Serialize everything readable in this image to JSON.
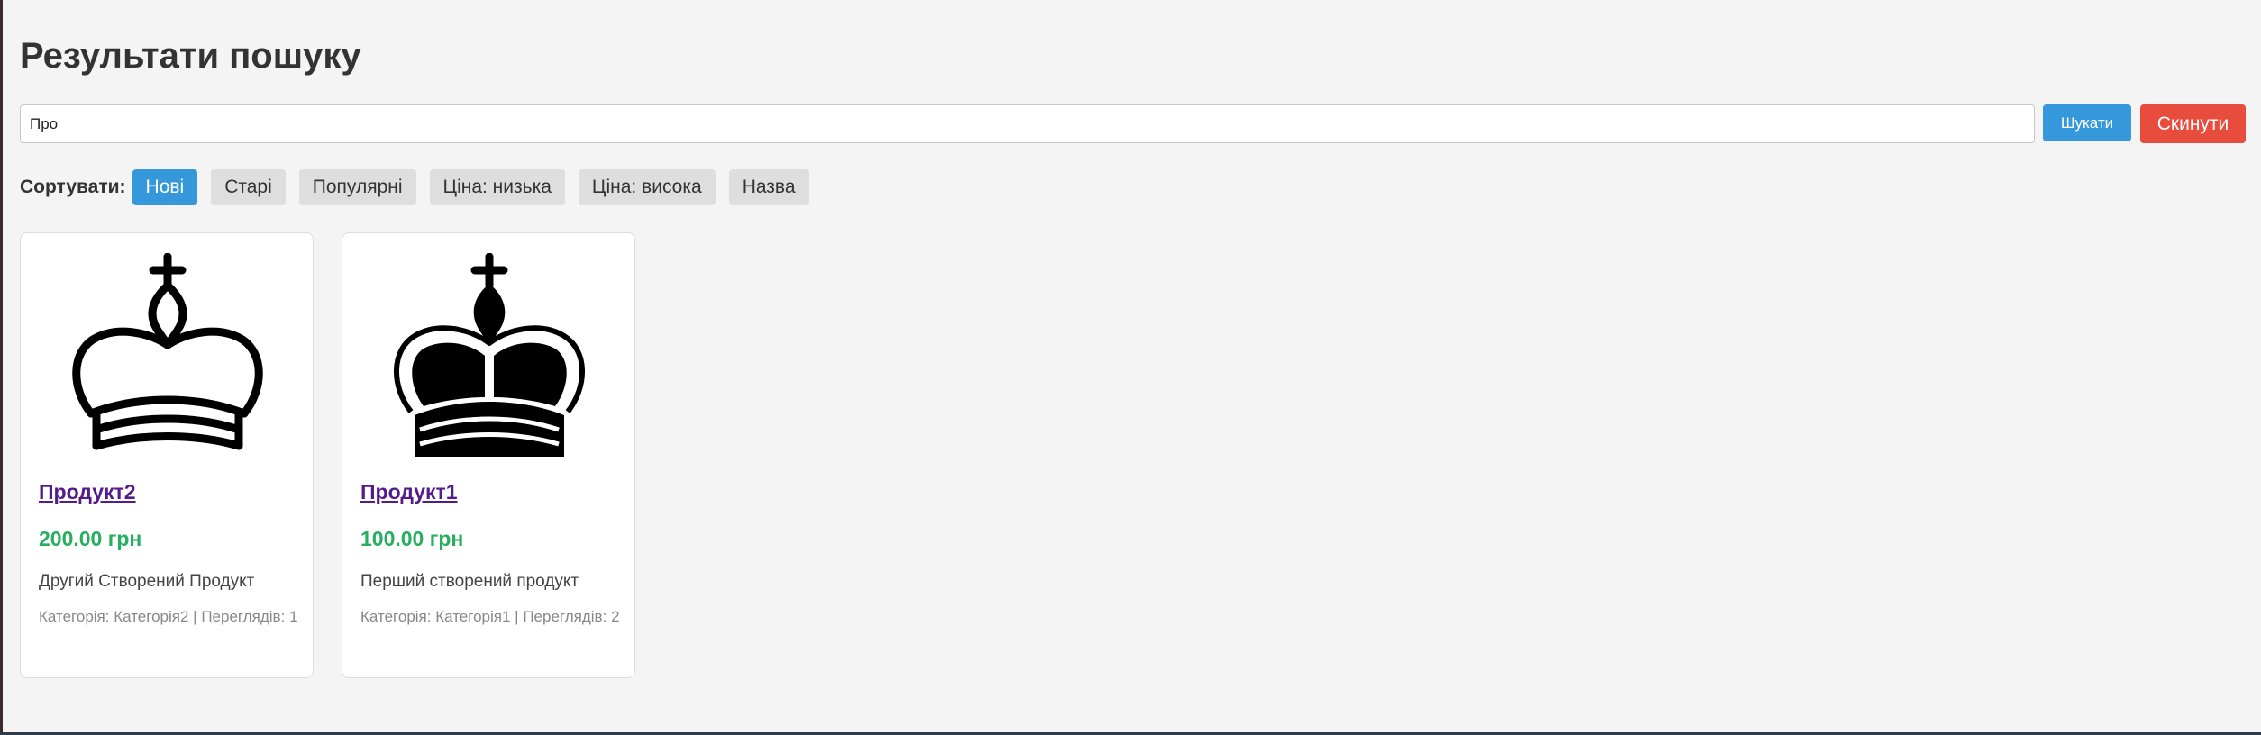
{
  "page": {
    "title": "Результати пошуку"
  },
  "search": {
    "value": "Про",
    "search_button": "Шукати",
    "reset_button": "Скинути"
  },
  "sort": {
    "label": "Сортувати:",
    "options": [
      "Нові",
      "Старі",
      "Популярні",
      "Ціна: низька",
      "Ціна: висока",
      "Назва"
    ],
    "active": "Нові"
  },
  "products": [
    {
      "name": "Продукт2",
      "price": "200.00 грн",
      "description": "Другий Створений Продукт",
      "category_label": "Категорія:",
      "category": "Категорія2",
      "views_label": "Переглядів:",
      "views": "1",
      "image": "white-king-icon"
    },
    {
      "name": "Продукт1",
      "price": "100.00 грн",
      "description": "Перший створений продукт",
      "category_label": "Категорія:",
      "category": "Категорія1",
      "views_label": "Переглядів:",
      "views": "2",
      "image": "black-king-icon"
    }
  ],
  "colors": {
    "search_button": "#3498db",
    "reset_button": "#e74c3c",
    "active_sort": "#3498db",
    "price": "#27ae60",
    "link": "#551a8b"
  }
}
